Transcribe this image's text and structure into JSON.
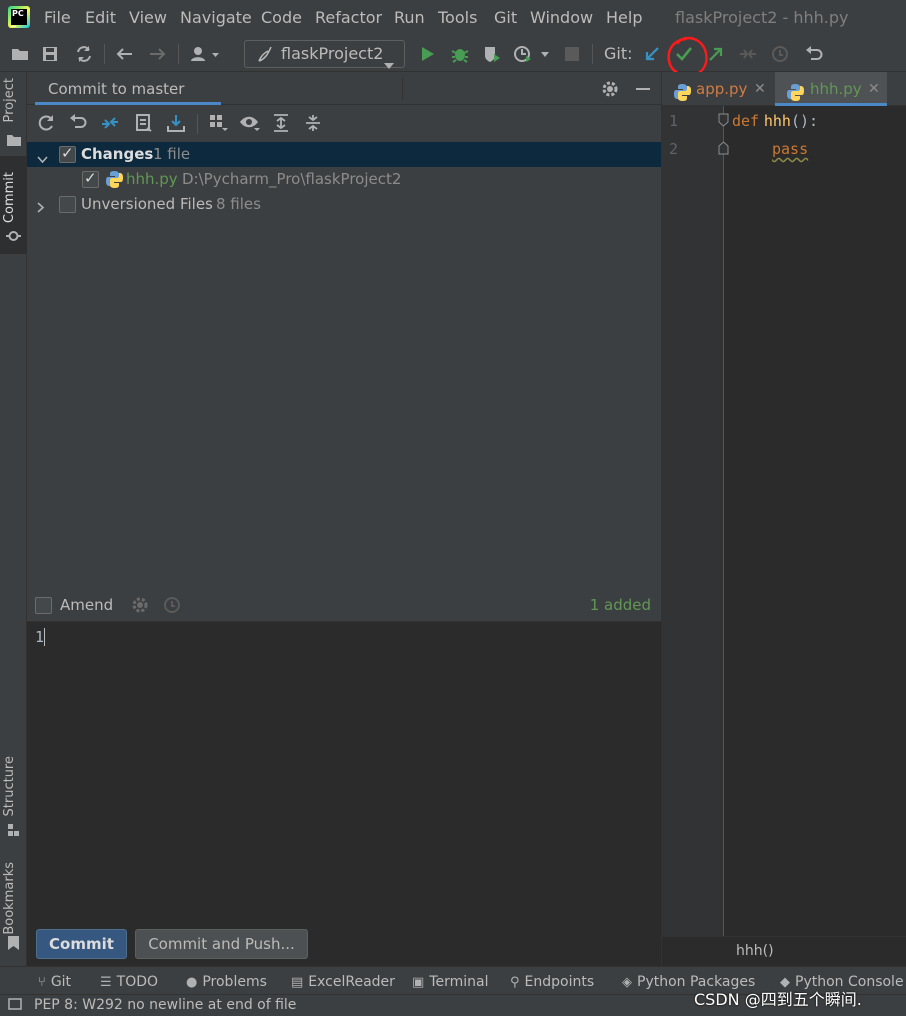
{
  "menu": [
    "File",
    "Edit",
    "View",
    "Navigate",
    "Code",
    "Refactor",
    "Run",
    "Tools",
    "Git",
    "Window",
    "Help"
  ],
  "window_title": "flaskProject2 - hhh.py",
  "toolbar": {
    "project_selector": "flaskProject2",
    "git_label": "Git:"
  },
  "side_tabs": {
    "project": "Project",
    "commit": "Commit",
    "structure": "Structure",
    "bookmarks": "Bookmarks"
  },
  "commit_panel": {
    "tab_title": "Commit to master",
    "changes": {
      "label": "Changes",
      "count": "1 file"
    },
    "file": {
      "name": "hhh.py",
      "path": "D:\\Pycharm_Pro\\flaskProject2"
    },
    "unversioned": {
      "label": "Unversioned Files",
      "count": "8 files"
    },
    "amend_label": "Amend",
    "status": "1 added",
    "message": "1",
    "commit_button": "Commit",
    "commit_push_button": "Commit and Push..."
  },
  "editor": {
    "tabs": [
      "app.py",
      "hhh.py"
    ],
    "line_numbers": [
      "1",
      "2"
    ],
    "code": {
      "kw_def": "def",
      "fn": "hhh",
      "paren": "():",
      "kw_pass": "pass"
    },
    "breadcrumb": "hhh()"
  },
  "bottom_tools": [
    "Git",
    "TODO",
    "Problems",
    "ExcelReader",
    "Terminal",
    "Endpoints",
    "Python Packages",
    "Python Console"
  ],
  "status_message": "PEP 8: W292 no newline at end of file",
  "watermark": "CSDN @四到五个瞬间.",
  "colors": {
    "accent": "#4a88c7",
    "vcs_added": "#629755",
    "annotation": "#ff1a1a",
    "keyword": "#cc7832",
    "function": "#ffc66d"
  }
}
